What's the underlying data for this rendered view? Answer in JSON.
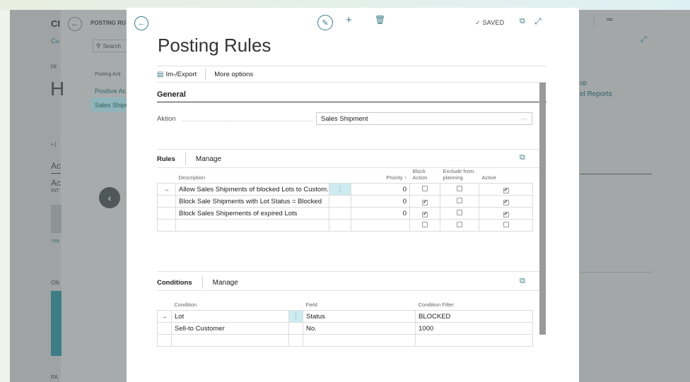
{
  "background": {
    "left_title": "CI",
    "left_sub": "Cu",
    "tab_title": "POSTING RU",
    "search_label": "Search",
    "side_items": [
      "Posting Acti",
      "Positive Ac",
      "Sales Shipn"
    ],
    "hl": "HI",
    "big_h": "H",
    "dot_label": "• (",
    "ac1": "Ac",
    "ac2": "Ac",
    "int": "INT",
    "lea": "Lea",
    "on": "ON",
    "pa": "PA",
    "right_up": "up",
    "right_reports": "el Reports"
  },
  "modal": {
    "saved": "SAVED",
    "title": "Posting Rules",
    "toolbar": {
      "imexport": "Im-/Export",
      "more": "More options"
    },
    "general": {
      "title": "General",
      "aktion_label": "Aktion",
      "aktion_value": "Sales Shipment",
      "aktion_more": "···"
    },
    "rules": {
      "tab_label": "Rules",
      "manage_label": "Manage",
      "columns": {
        "description": "Description",
        "priority": "Priority ↑",
        "block_action": "Block Action",
        "exclude": "Exclude from planning",
        "active": "Active"
      },
      "rows": [
        {
          "arrow": "→",
          "description": "Allow Sales Shipments of blocked Lots to Custom...",
          "drag": "⋮",
          "priority": "0",
          "block": false,
          "exclude": false,
          "active": true
        },
        {
          "arrow": "",
          "description": "Block Sale Shipments with Lot Status = Blocked",
          "drag": "",
          "priority": "0",
          "block": true,
          "exclude": false,
          "active": true
        },
        {
          "arrow": "",
          "description": "Block Sales Shipements of expired Lots",
          "drag": "",
          "priority": "0",
          "block": true,
          "exclude": false,
          "active": true
        },
        {
          "arrow": "",
          "description": "",
          "drag": "",
          "priority": "",
          "block": false,
          "exclude": false,
          "active": false
        }
      ]
    },
    "conditions": {
      "tab_label": "Conditions",
      "manage_label": "Manage",
      "columns": {
        "condition": "Condition",
        "field": "Field",
        "filter": "Condition Filter"
      },
      "rows": [
        {
          "arrow": "→",
          "condition": "Lot",
          "drag": "⋮",
          "field": "Status",
          "filter": "BLOCKED"
        },
        {
          "arrow": "",
          "condition": "Sell-to Customer",
          "drag": "",
          "field": "No.",
          "filter": "1000"
        },
        {
          "arrow": "",
          "condition": "",
          "drag": "",
          "field": "",
          "filter": ""
        }
      ]
    }
  },
  "colors": {
    "accent": "#3a7d86",
    "drag_highlight": "#cdebf0"
  }
}
